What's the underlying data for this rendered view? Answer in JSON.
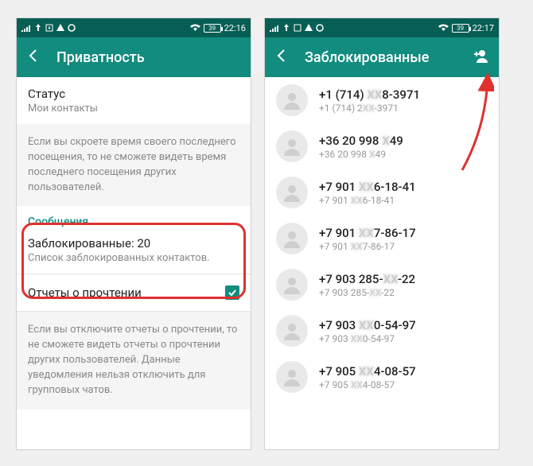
{
  "colors": {
    "primary": "#128c7e",
    "primaryDark": "#075e54",
    "highlight": "#e0312f"
  },
  "left": {
    "status": {
      "battery": "39",
      "time": "22:16"
    },
    "title": "Приватность",
    "statusRow": {
      "title": "Статус",
      "sub": "Мои контакты"
    },
    "info1": "Если вы скроете время своего последнего посещения, то не сможете видеть время последнего посещения других пользователей.",
    "msgSection": "Сообщения",
    "blocked": {
      "title": "Заблокированные: 20",
      "sub": "Список заблокированных контактов."
    },
    "readRow": {
      "title": "Отчеты о прочтении",
      "checked": true
    },
    "info2": "Если вы отключите отчеты о прочтении, то не сможете видеть отчеты о прочтении других пользователей. Данные уведомления нельзя отключить для групповых чатов."
  },
  "right": {
    "status": {
      "battery": "39",
      "time": "22:17"
    },
    "title": "Заблокированные",
    "contacts": [
      {
        "p1a": "+1 (714) ",
        "p1m": "XX",
        "p1b": "8-3971",
        "p2a": "+1 (714) 2",
        "p2m": "XX",
        "p2b": "-3971"
      },
      {
        "p1a": "+36 20 998 ",
        "p1m": "X",
        "p1b": "49",
        "p2a": "+36 20 998 ",
        "p2m": "X",
        "p2b": "49"
      },
      {
        "p1a": "+7 901 ",
        "p1m": "XX",
        "p1b": "6-18-41",
        "p2a": "+7 901 ",
        "p2m": "XX",
        "p2b": "6-18-41"
      },
      {
        "p1a": "+7 901 ",
        "p1m": "XX",
        "p1b": "7-86-17",
        "p2a": "+7 901 ",
        "p2m": "XX",
        "p2b": "7-86-17"
      },
      {
        "p1a": "+7 903 285-",
        "p1m": "XX",
        "p1b": "-22",
        "p2a": "+7 903 285-",
        "p2m": "XX",
        "p2b": "-22"
      },
      {
        "p1a": "+7 903 ",
        "p1m": "XX",
        "p1b": "0-54-97",
        "p2a": "+7 903 ",
        "p2m": "XX",
        "p2b": "0-54-97"
      },
      {
        "p1a": "+7 905 ",
        "p1m": "XX",
        "p1b": "4-08-57",
        "p2a": "+7 905 ",
        "p2m": "XX",
        "p2b": "4-08-57"
      }
    ]
  }
}
